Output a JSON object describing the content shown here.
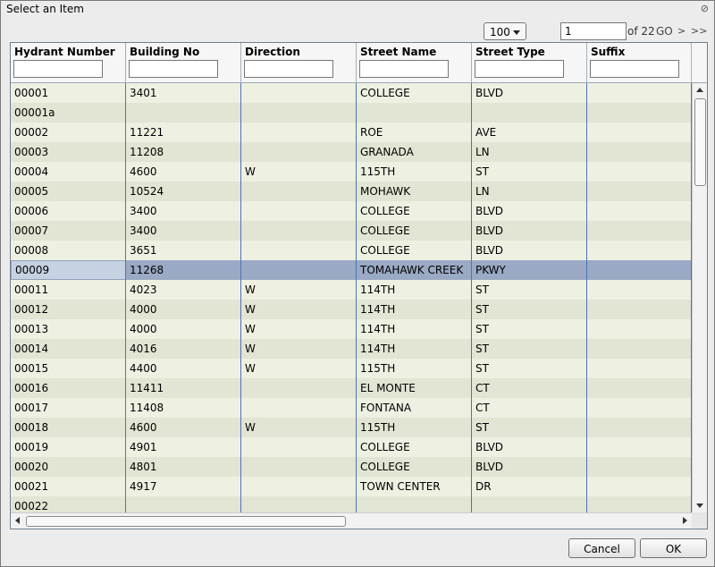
{
  "dialog": {
    "title": "Select an Item",
    "close_label": "⊘"
  },
  "pager": {
    "page_size": "100",
    "page_value": "1",
    "of_label": "of 22",
    "go_label": "GO",
    "next_label": ">",
    "last_label": ">>"
  },
  "columns": [
    {
      "key": "hydrant",
      "label": "Hydrant Number",
      "filter": ""
    },
    {
      "key": "building",
      "label": "Building No",
      "filter": ""
    },
    {
      "key": "direction",
      "label": "Direction",
      "filter": ""
    },
    {
      "key": "street",
      "label": "Street Name",
      "filter": ""
    },
    {
      "key": "type",
      "label": "Street Type",
      "filter": ""
    },
    {
      "key": "suffix",
      "label": "Suffix",
      "filter": ""
    }
  ],
  "selected_row": 9,
  "rows": [
    [
      "00001",
      "3401",
      "",
      "COLLEGE",
      "BLVD",
      ""
    ],
    [
      "00001a",
      "",
      "",
      "",
      "",
      ""
    ],
    [
      "00002",
      "11221",
      "",
      "ROE",
      "AVE",
      ""
    ],
    [
      "00003",
      "11208",
      "",
      "GRANADA",
      "LN",
      ""
    ],
    [
      "00004",
      "4600",
      "W",
      "115TH",
      "ST",
      ""
    ],
    [
      "00005",
      "10524",
      "",
      "MOHAWK",
      "LN",
      ""
    ],
    [
      "00006",
      "3400",
      "",
      "COLLEGE",
      "BLVD",
      ""
    ],
    [
      "00007",
      "3400",
      "",
      "COLLEGE",
      "BLVD",
      ""
    ],
    [
      "00008",
      "3651",
      "",
      "COLLEGE",
      "BLVD",
      ""
    ],
    [
      "00009",
      "11268",
      "",
      "TOMAHAWK CREEK",
      "PKWY",
      ""
    ],
    [
      "00011",
      "4023",
      "W",
      "114TH",
      "ST",
      ""
    ],
    [
      "00012",
      "4000",
      "W",
      "114TH",
      "ST",
      ""
    ],
    [
      "00013",
      "4000",
      "W",
      "114TH",
      "ST",
      ""
    ],
    [
      "00014",
      "4016",
      "W",
      "114TH",
      "ST",
      ""
    ],
    [
      "00015",
      "4400",
      "W",
      "115TH",
      "ST",
      ""
    ],
    [
      "00016",
      "11411",
      "",
      "EL MONTE",
      "CT",
      ""
    ],
    [
      "00017",
      "11408",
      "",
      "FONTANA",
      "CT",
      ""
    ],
    [
      "00018",
      "4600",
      "W",
      "115TH",
      "ST",
      ""
    ],
    [
      "00019",
      "4901",
      "",
      "COLLEGE",
      "BLVD",
      ""
    ],
    [
      "00020",
      "4801",
      "",
      "COLLEGE",
      "BLVD",
      ""
    ],
    [
      "00021",
      "4917",
      "",
      "TOWN CENTER",
      "DR",
      ""
    ],
    [
      "00022",
      "",
      "",
      "",
      "",
      ""
    ]
  ],
  "buttons": {
    "cancel": "Cancel",
    "ok": "OK"
  },
  "colors": {
    "selected_row": "#9aa9c4",
    "grid_line": "#4b74b8"
  }
}
